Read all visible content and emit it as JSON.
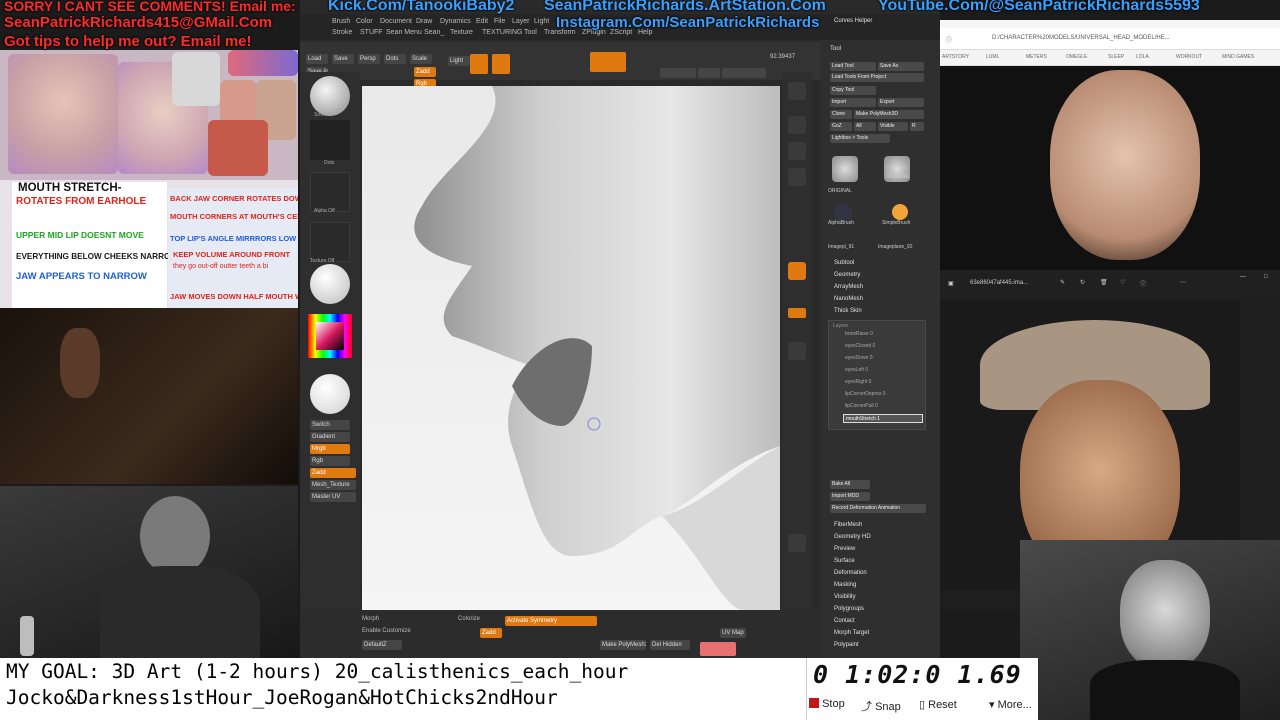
{
  "banner": {
    "line1_red": "SORRY I CANT SEE COMMENTS! Email me:",
    "line1_blue": "Kick.Com/TanookiBaby2",
    "line1_white": "SeanPatrickRichards.ArtStation.Com",
    "line1_blue2": "YouTube.Com/@SeanPatrickRichards5593",
    "line2_red": "SeanPatrickRichards415@GMail.Com",
    "line2_blue": "Instagram.Com/SeanPatrickRichards",
    "line3_red": "Got tips to help me out? Email me!"
  },
  "notes": {
    "title": "MOUTH STRETCH-",
    "items_left": [
      {
        "text": "ROTATES FROM EARHOLE",
        "color": "#e0241c"
      },
      {
        "text": "UPPER MID LIP DOESNT MOVE",
        "color": "#1fa31f"
      },
      {
        "text": "EVERYTHING BELOW CHEEKS NARROWS",
        "color": "#1a1a1a"
      },
      {
        "text": "JAW APPEARS TO NARROW",
        "color": "#1f5fd6"
      }
    ],
    "items_right": [
      {
        "text": "BACK JAW CORNER ROTATES DOWN/BA",
        "color": "#e0241c"
      },
      {
        "text": "MOUTH CORNERS AT MOUTH'S CENTE",
        "color": "#e0241c"
      },
      {
        "text": "TOP LIP'S ANGLE MIRRRORS LOW LI",
        "color": "#1f5fd6"
      },
      {
        "text": "KEEP VOLUME AROUND FRONT",
        "color": "#e0241c"
      },
      {
        "text": "they go out-off outter teeth a bi",
        "color": "#e0241c"
      },
      {
        "text": "JAW MOVES DOWN HALF MOUTH WIDT",
        "color": "#e0241c"
      }
    ]
  },
  "zbrush": {
    "menu": [
      "Brush",
      "Color",
      "Document",
      "Draw",
      "Dynamics",
      "Edit",
      "File",
      "Layer",
      "Light"
    ],
    "menu2": [
      "Stroke",
      "STUFF",
      "Sean Menu",
      "Sean_",
      "Texture",
      "TEXTURING",
      "Tool",
      "Transform",
      "ZPlugin",
      "ZScript",
      "Help"
    ],
    "toolbar_buttons": [
      "Load",
      "Save",
      "Save As",
      "Persp",
      "Dots",
      "Scale",
      "Rotate",
      "Move",
      "Zadd",
      "Zsub",
      "Rgb",
      "Light",
      "Edit",
      "Draw"
    ],
    "coord_readout": "92.39437",
    "right_tabs": [
      "Curves Helper",
      "Tool"
    ],
    "right_buttons": [
      "Load Tool",
      "Save As",
      "Load Tools From Project",
      "Copy Tool",
      "Import",
      "Export",
      "Clone",
      "Make PolyMesh3D",
      "GoZ",
      "All",
      "Visible",
      "R",
      "Lightbox > Tools"
    ],
    "thumb_labels": [
      "ORIGINAL",
      "ORIGINAL",
      "AlphaBrush",
      "SimpleBrush",
      "Imagepl_91",
      "Imageplane_92"
    ],
    "subtool_menu": [
      "Subtool",
      "Geometry",
      "ArrayMesh",
      "NanoMesh",
      "Thick Skin"
    ],
    "morph_title": "Layers",
    "morph_items": [
      "browRaise 0",
      "eyesClosed 0",
      "eyesDown 0",
      "eyesLeft 0",
      "eyesRight 0",
      "lipCornerDepres 0",
      "lipCornerPull 0",
      "mouthStretch 1"
    ],
    "morph_active": "mouthStretch 1",
    "bake_buttons": [
      "Bake All",
      "Import MDD",
      "Record Deformation Animation"
    ],
    "lower_menu": [
      "FiberMesh",
      "Geometry HD",
      "Preview",
      "Surface",
      "Deformation",
      "Masking",
      "Visibility",
      "Polygroups",
      "Contact",
      "Morph Target",
      "Polypaint"
    ],
    "left_labels": [
      "Smooth",
      "Dots",
      "Alpha Off",
      "Texture Off",
      "SkinShade4",
      "Gradient",
      "Switch",
      "Gradient",
      "Mrgb",
      "Rgb",
      "M",
      "Zadd",
      "Mesh_Texture",
      "Master UV"
    ],
    "bottom_labels": [
      "Morph",
      "Enable Customize",
      "DefaultZ",
      "Colorize",
      "Activate Symmetry",
      "Make PolyMesh3D",
      "Del Hidden",
      "Zadd",
      "UV Map"
    ]
  },
  "browser": {
    "address": "D:/CHARACTER%20MODELS/UNIVERSAL_HEAD_MODEL/HE...",
    "bookmarks": [
      "ARTSTORY",
      "LUML",
      "METERS",
      "OMEGLE",
      "SLEEP",
      "LOLA",
      "WORKOUT",
      "MIND GAMES"
    ]
  },
  "viewer": {
    "filename": "63e86047af445.ima..."
  },
  "goal": {
    "line1": "MY GOAL: 3D Art (1-2 hours) 20_calisthenics_each_hour",
    "line2": "Jocko&Darkness1stHour_JoeRogan&HotChicks2ndHour"
  },
  "timer": {
    "value": "0 1:02:0 1.69",
    "stop_label": "Stop",
    "snap_label": "Snap",
    "reset_label": "Reset",
    "more_label": "More..."
  },
  "colors": {
    "accent_orange": "#e07a10",
    "banner_red": "#ff2a2a",
    "banner_blue": "#3aa0ff"
  }
}
